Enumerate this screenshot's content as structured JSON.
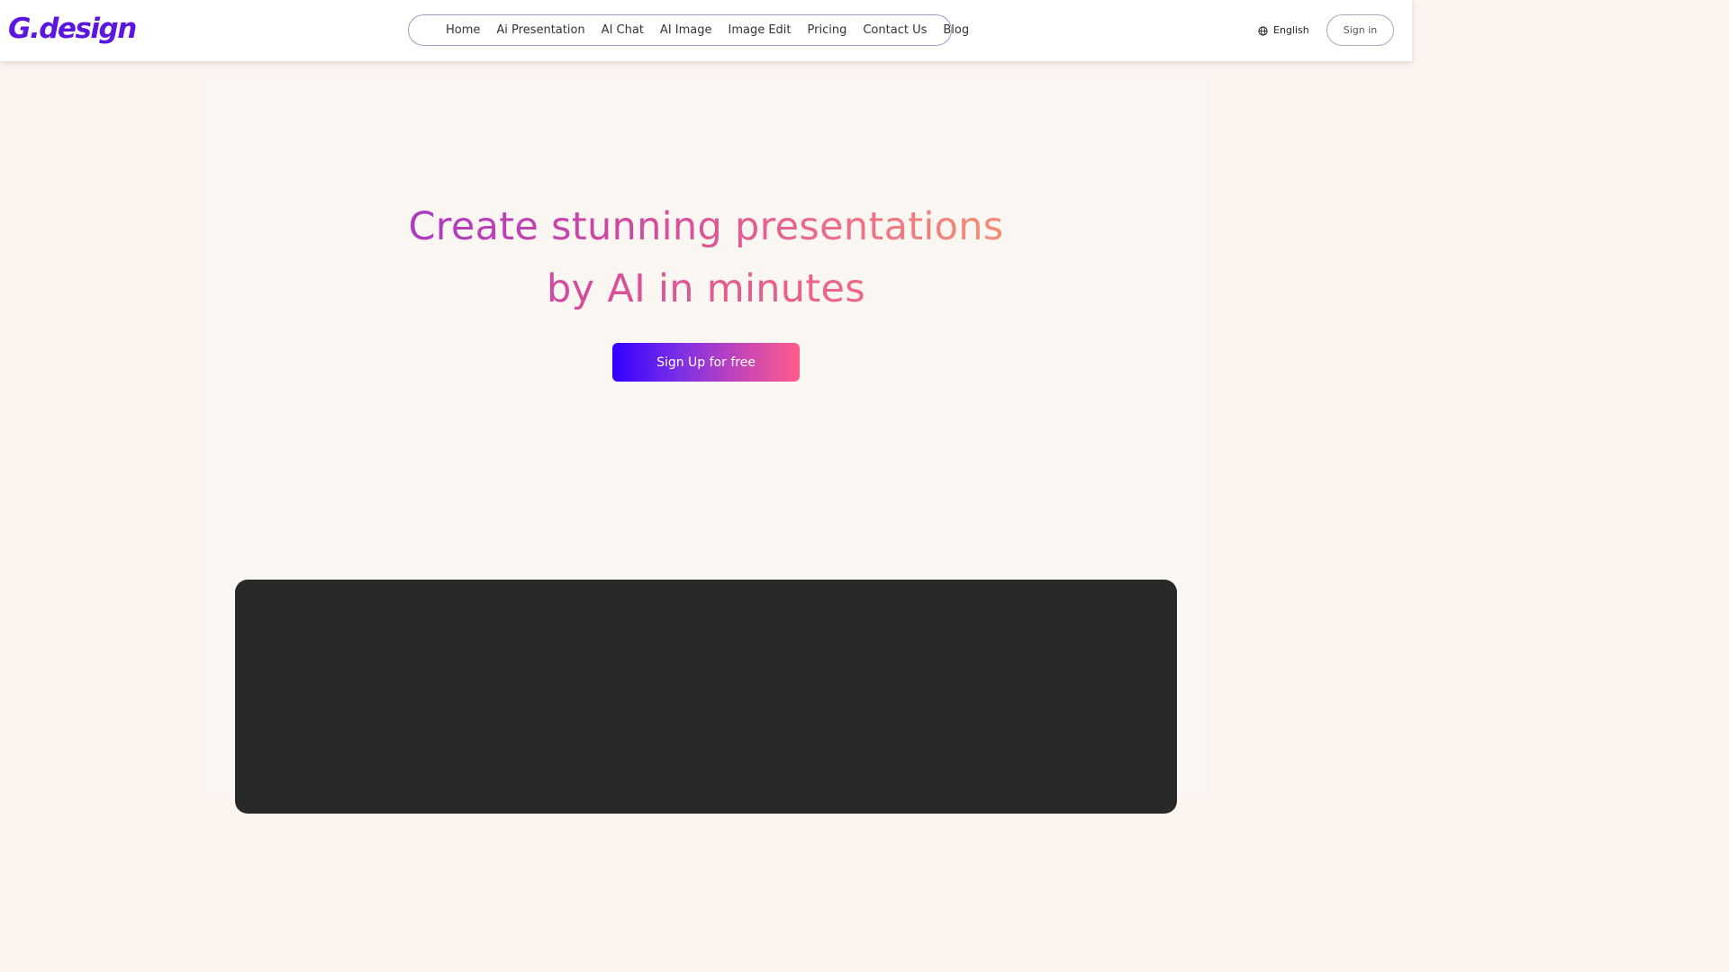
{
  "header": {
    "logo_text": "G.design",
    "nav_items": [
      "Home",
      "Ai Presentation",
      "AI Chat",
      "AI Image",
      "Image Edit",
      "Pricing",
      "Contact Us",
      "Blog"
    ],
    "language": "English",
    "language_icon": "globe-icon",
    "sign_in_label": "Sign in"
  },
  "hero": {
    "title_line1": "Create stunning presentations",
    "title_line2": "by AI in minutes",
    "cta_label": "Sign Up for free"
  },
  "colors": {
    "logo": "#5b17e0",
    "background": "#fbf4ef",
    "cta_gradient_start": "#3300ff",
    "cta_gradient_end": "#ff5c8a",
    "video_panel": "#282828"
  }
}
